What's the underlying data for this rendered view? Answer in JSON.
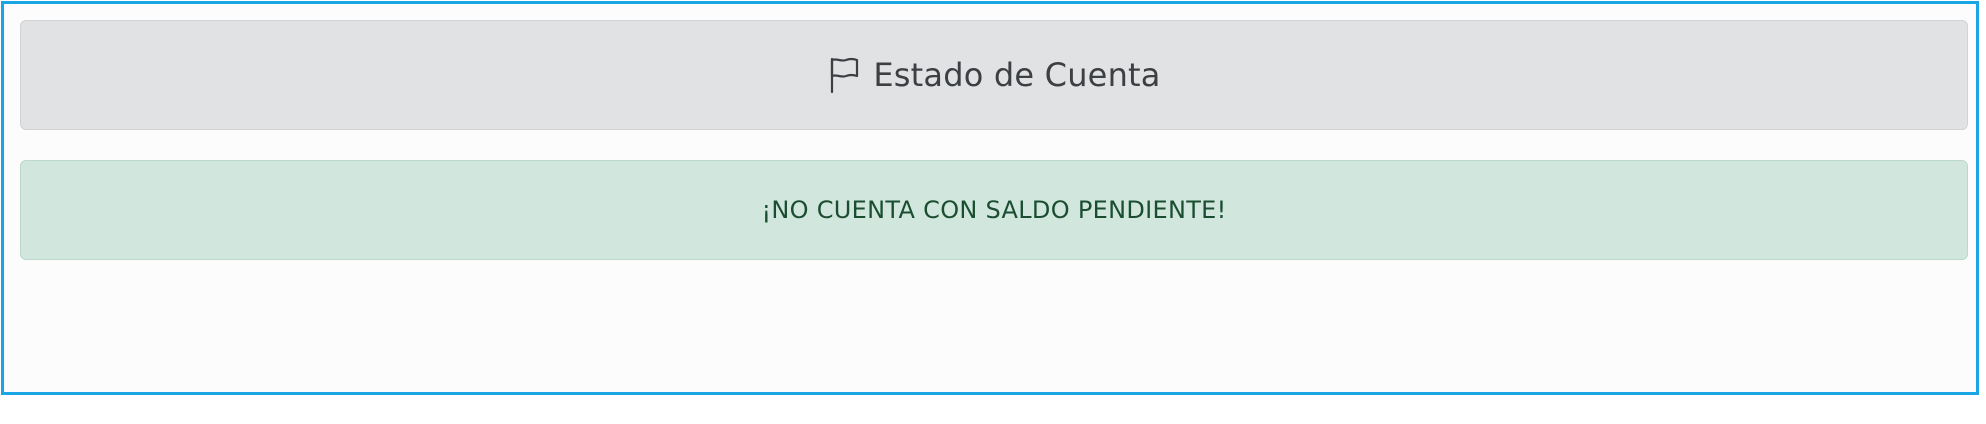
{
  "header": {
    "icon": "flag-icon",
    "title": "Estado de Cuenta"
  },
  "alert": {
    "message": "¡NO CUENTA CON SALDO PENDIENTE!",
    "color": "#d1e7de",
    "text_color": "#1b4e31"
  },
  "colors": {
    "frame_border": "#1aa6e4",
    "header_bg": "#e1e2e4"
  }
}
